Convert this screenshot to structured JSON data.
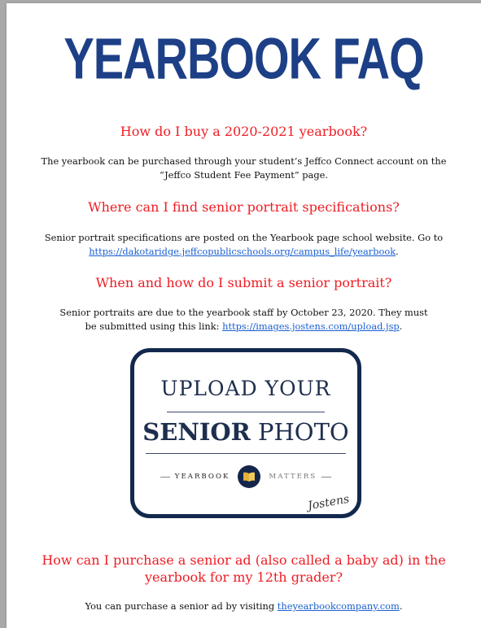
{
  "title": "YEARBOOK FAQ",
  "faq": [
    {
      "question": "How do I buy a 2020-2021 yearbook?",
      "answer": "The yearbook can be purchased through your student’s Jeffco Connect account on the “Jeffco Student Fee Payment” page."
    },
    {
      "question": "Where can I find senior portrait specifications?",
      "answer_pre": "Senior portrait specifications are posted on the Yearbook page school website. Go to",
      "answer_link": "https://dakotaridge.jeffcopublicschools.org/campus_life/yearbook",
      "answer_post": "."
    },
    {
      "question": "When and how do I submit a senior portrait?",
      "answer_pre": "Senior portraits are due to the yearbook staff by October 23, 2020. They must be submitted using this link:",
      "answer_link": "https://images.jostens.com/upload.jsp",
      "answer_post": "."
    },
    {
      "question": "How can I purchase a senior ad (also called a baby ad) in the yearbook for my 12th grader?",
      "answer_pre": "You can purchase a senior ad by visiting",
      "answer_link": "theyearbookcompany.com",
      "answer_post": "."
    }
  ],
  "badge": {
    "line1": "UPLOAD YOUR",
    "line2_bold": "SENIOR",
    "line2_rest": "PHOTO",
    "left_word": "YEARBOOK",
    "right_word": "MATTERS",
    "brand": "Jostens",
    "icon": "book-icon"
  },
  "colors": {
    "title": "#1d3f86",
    "question": "#ee1c24",
    "link": "#1a5fd0",
    "badge_border": "#12284d"
  }
}
